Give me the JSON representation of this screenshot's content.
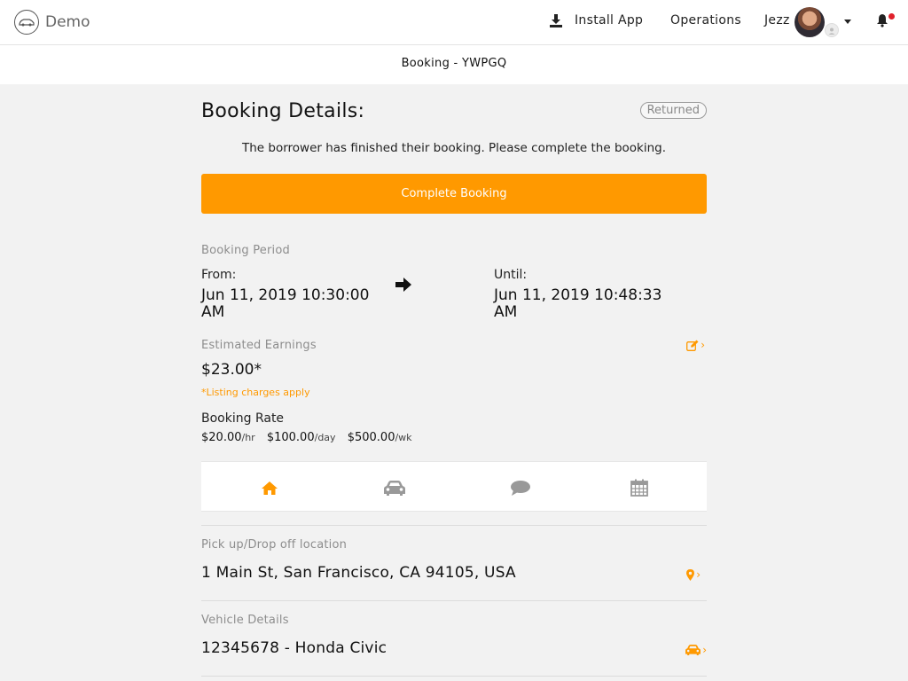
{
  "nav": {
    "brand": "Demo",
    "install": "Install App",
    "operations": "Operations",
    "user": "Jezz"
  },
  "subheader": {
    "title": "Booking - YWPGQ"
  },
  "booking": {
    "title": "Booking Details:",
    "status": "Returned",
    "notice": "The borrower has finished their booking. Please complete the booking.",
    "complete_button": "Complete Booking",
    "period_label": "Booking Period",
    "from_label": "From:",
    "from_value": "Jun 11, 2019 10:30:00 AM",
    "until_label": "Until:",
    "until_value": "Jun 11, 2019 10:48:33 AM",
    "earnings_label": "Estimated Earnings",
    "earnings_value": "$23.00*",
    "earnings_note": "*Listing charges apply",
    "rate_label": "Booking Rate",
    "rates": [
      {
        "amount": "$20.00",
        "unit": "/hr"
      },
      {
        "amount": "$100.00",
        "unit": "/day"
      },
      {
        "amount": "$500.00",
        "unit": "/wk"
      }
    ],
    "tabs": [
      "home-icon",
      "car-icon",
      "chat-icon",
      "calendar-icon"
    ],
    "location_label": "Pick up/Drop off location",
    "location_value": "1 Main St, San Francisco, CA 94105, USA",
    "vehicle_label": "Vehicle Details",
    "vehicle_value": "12345678 - Honda Civic"
  },
  "colors": {
    "accent": "#ff9900",
    "muted": "#8d8d8d",
    "notify": "#e0212b"
  }
}
